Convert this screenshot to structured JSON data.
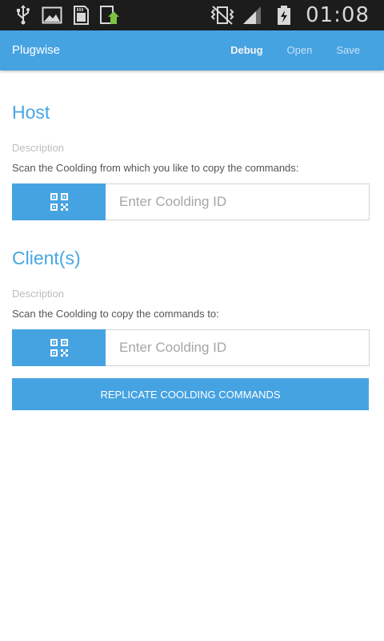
{
  "status_bar": {
    "left_icons": [
      "usb-icon",
      "gallery-icon",
      "sd-card-icon",
      "upload-icon"
    ],
    "right_icons": [
      "vibrate-icon",
      "signal-icon",
      "battery-charging-icon"
    ],
    "time": "01:08"
  },
  "action_bar": {
    "title": "Plugwise",
    "actions": {
      "debug": "Debug",
      "open": "Open",
      "save": "Save"
    }
  },
  "host": {
    "title": "Host",
    "description_label": "Description",
    "description": "Scan the Coolding from which you like to copy the commands:",
    "input_placeholder": "Enter Coolding ID",
    "input_value": ""
  },
  "clients": {
    "title": "Client(s)",
    "description_label": "Description",
    "description": "Scan the Coolding to copy the commands to:",
    "input_placeholder": "Enter Coolding ID",
    "input_value": ""
  },
  "replicate_button": "REPLICATE COOLDING COMMANDS",
  "colors": {
    "accent": "#46a3e2",
    "title": "#47a6e4",
    "status_bar": "#1c1c1c"
  }
}
